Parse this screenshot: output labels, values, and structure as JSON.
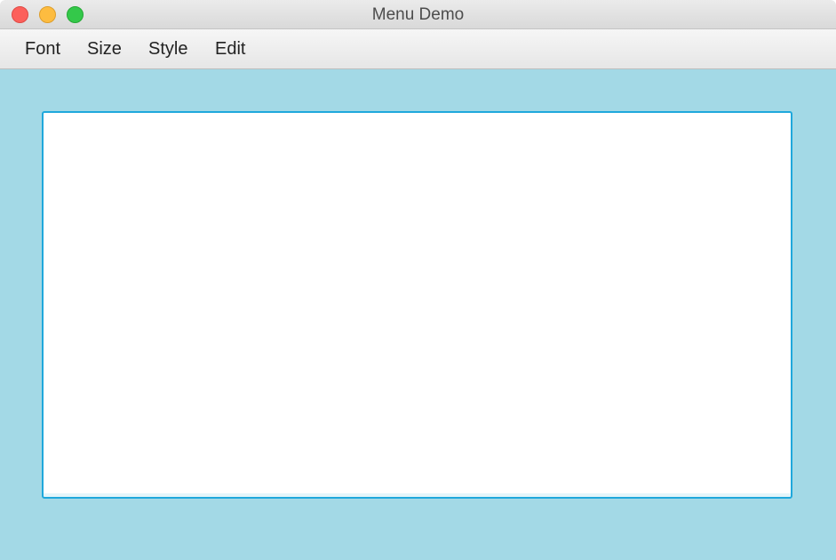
{
  "window": {
    "title": "Menu Demo"
  },
  "menubar": {
    "items": [
      {
        "label": "Font"
      },
      {
        "label": "Size"
      },
      {
        "label": "Style"
      },
      {
        "label": "Edit"
      }
    ]
  },
  "text_area": {
    "value": ""
  },
  "colors": {
    "background": "#a3d9e6",
    "focus_border": "#1fa8dc",
    "close": "#fc605b",
    "minimize": "#fdbc40",
    "zoom": "#34c84a"
  }
}
